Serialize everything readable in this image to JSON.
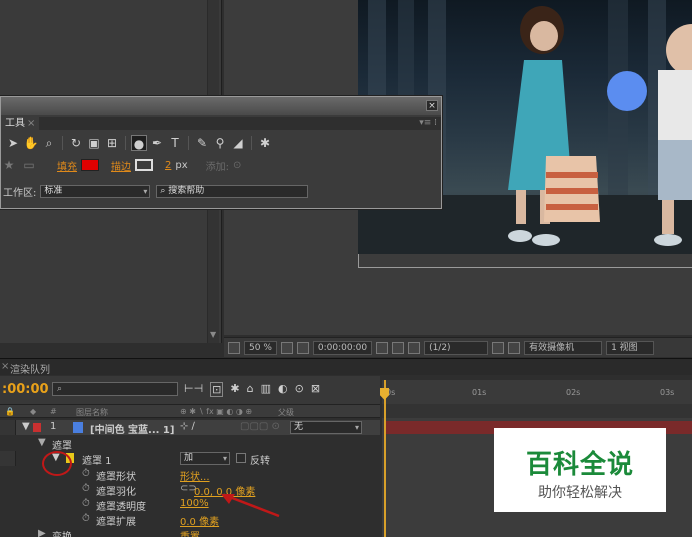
{
  "tools_panel": {
    "tab_label": "工具",
    "fill_label": "填充",
    "fill_color": "#e00000",
    "stroke_label": "描边",
    "stroke_width_value": "2",
    "stroke_width_unit": "px",
    "add_label": "添加:",
    "workspace_label": "工作区:",
    "workspace_value": "标准",
    "search_help": "搜索帮助"
  },
  "viewer": {
    "zoom": "50 %",
    "timecode": "0:00:00:00",
    "resolution": "(1/2)",
    "camera": "有效摄像机",
    "views": "1 视图",
    "circle_color": "#5b8df0"
  },
  "timeline": {
    "render_queue_tab": "渲染队列",
    "current_time": ":00:00",
    "col_source_name": "图层名称",
    "col_parent": "父级",
    "ruler_labels": [
      "0s",
      "01s",
      "02s",
      "03s"
    ],
    "layer": {
      "index": "1",
      "name": "[中间色 宝蓝... 1]",
      "parent_value": "无"
    },
    "masks_group": "遮罩",
    "mask1_label": "遮罩 1",
    "mask_mode": "加",
    "invert_label": "反转",
    "properties": [
      {
        "label": "遮罩形状",
        "value": "形状..."
      },
      {
        "label": "遮罩羽化",
        "value": "0.0, 0.0 像素"
      },
      {
        "label": "遮罩透明度",
        "value": "100%"
      },
      {
        "label": "遮罩扩展",
        "value": "0.0 像素"
      }
    ],
    "transform_label": "变换",
    "transform_reset": "重置"
  },
  "watermark": {
    "title": "百科全说",
    "subtitle": "助你轻松解决"
  }
}
